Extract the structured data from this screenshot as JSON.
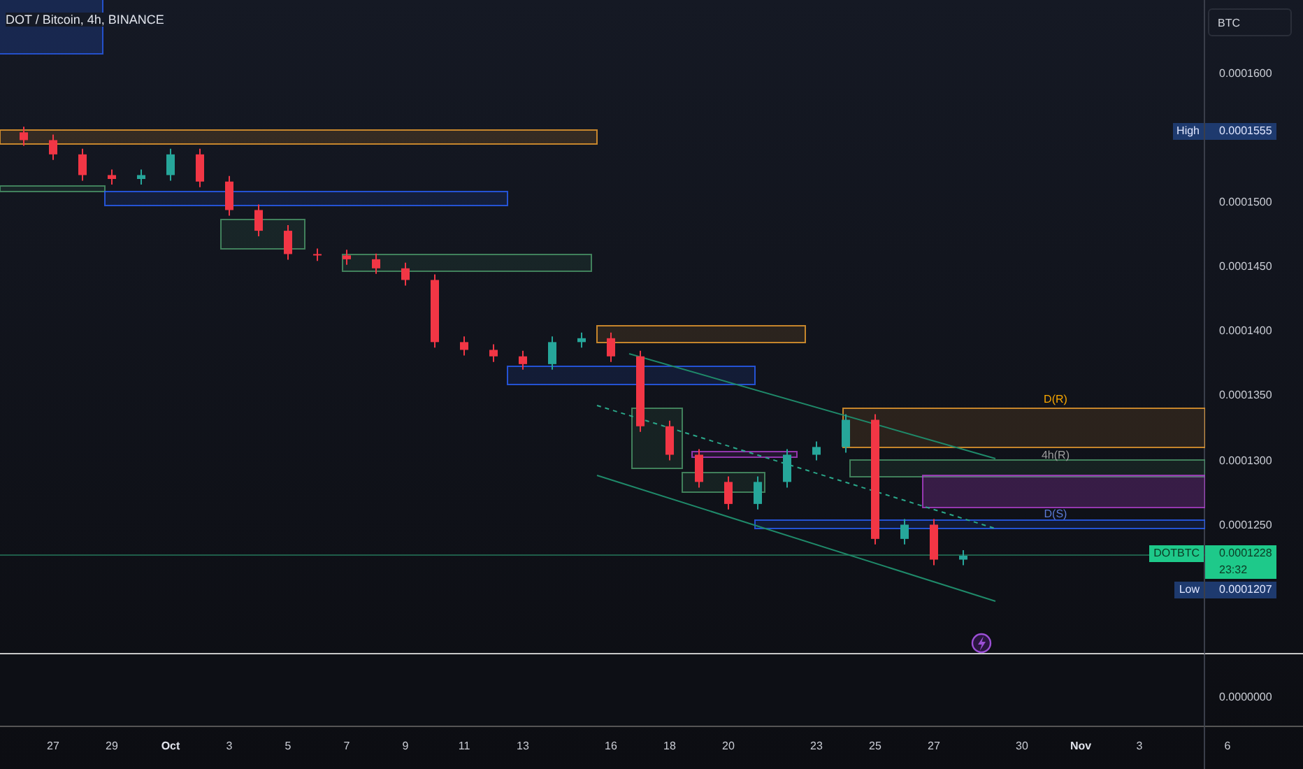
{
  "header": {
    "title": "DOT / Bitcoin, 4h, BINANCE"
  },
  "price_axis": {
    "currency": "BTC",
    "ticks": [
      "0.0001600",
      "0.0001500",
      "0.0001450",
      "0.0001400",
      "0.0001350",
      "0.0001300",
      "0.0001250"
    ],
    "high": {
      "label": "High",
      "value": "0.0001555"
    },
    "last": {
      "symbol": "DOTBTC",
      "value": "0.0001228",
      "countdown": "23:32"
    },
    "low": {
      "label": "Low",
      "value": "0.0001207"
    }
  },
  "zones": [
    {
      "label": "D(R)",
      "color": "#f7a600"
    },
    {
      "label": "4h(R)",
      "color": "#9e9e9e"
    },
    {
      "label": "D(S)",
      "color": "#5b7bd6"
    }
  ],
  "time_axis": {
    "labels": [
      "27",
      "29",
      "Oct",
      "3",
      "5",
      "7",
      "9",
      "11",
      "13",
      "16",
      "18",
      "20",
      "23",
      "25",
      "27",
      "30",
      "Nov",
      "3",
      "6"
    ]
  },
  "lower_pane": {
    "value": "0.0000000"
  }
}
